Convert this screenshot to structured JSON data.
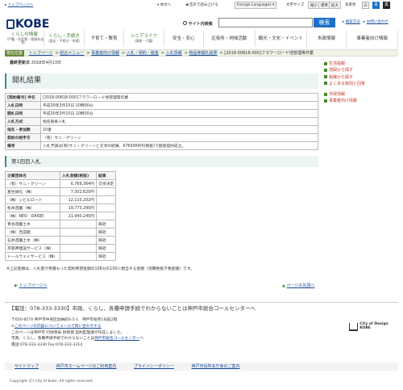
{
  "topbar": {
    "top_link": "トップページへ",
    "text_size": "本文へ",
    "voice": "音声で読み上げる",
    "language": "Foreign Languages",
    "char_size": "文字サイズ",
    "reduce": "縮小",
    "standard": "標準",
    "enlarge": "拡大",
    "bg_color": "背景色",
    "colors": [
      {
        "label": "白",
        "color": "#ffffff",
        "text": "#333333"
      },
      {
        "label": "青",
        "color": "#1d6fc7",
        "text": "#ffffff"
      },
      {
        "label": "黒",
        "color": "#222222",
        "text": "#ffffff"
      }
    ]
  },
  "header": {
    "logo": "KOBE",
    "search_label": "サイト内検索",
    "search_placeholder": "",
    "search_button": "検索",
    "search_help": "検索方法",
    "search_use": "サイトの使い方",
    "contact": "お問い合わせ"
  },
  "nav": [
    {
      "label": "くらしの情報",
      "sub": "（戸籍・住民票・保険年金等）"
    },
    {
      "label": "くらし・手続き",
      "sub": "（届出・手続き・申請）"
    },
    {
      "label": "子育て・教育",
      "sub": ""
    },
    {
      "label": "シニアライフ",
      "sub": "（高齢・介護）"
    },
    {
      "label": "安全・安心",
      "sub": ""
    },
    {
      "label": "区役所・地域活動",
      "sub": ""
    },
    {
      "label": "観光・文化・イベント",
      "sub": ""
    },
    {
      "label": "市政情報",
      "sub": ""
    },
    {
      "label": "事業者向け情報",
      "sub": ""
    }
  ],
  "breadcrumb": {
    "here": "現在位置",
    "items": [
      "トップページ",
      "総合メニュー",
      "事業者向け情報",
      "入札・契約・税金",
      "入札情報",
      "物品等開札結果"
    ],
    "current": "[2018-00818-000]フラワーロード他管理等作業"
  },
  "updated_label": "最終更新日",
  "updated_date": "2018年4月13日",
  "main_title": "開札結果",
  "info_rows": [
    {
      "label": "[契約番号] 件名",
      "value": "[2018-00818-000]フラワーロード他管理等作業"
    },
    {
      "label": "入札日時",
      "value": "平成30年3月15日 10時00分"
    },
    {
      "label": "開札日時",
      "value": "平成30年3月15日 10時30分"
    },
    {
      "label": "入札方式",
      "value": "指名競争入札"
    },
    {
      "label": "指名・参加数",
      "value": "10者"
    },
    {
      "label": "契約の相手方",
      "value": "（有）サニ・グリーン"
    },
    {
      "label": "備考",
      "value": "入札予調は(有)サニ・グリーンと交渉の結果、6769364円(税抜)で随意契約成立。"
    }
  ],
  "section_title": "第1回目入札",
  "bid_headers": [
    "企業団体名",
    "入札金額(税抜)",
    "結果"
  ],
  "bids": [
    {
      "name": "（有）サニ・グリーン",
      "amount": "6,769,364円",
      "result": "交渉決定"
    },
    {
      "name": "富生緑化（株）",
      "amount": "7,302,620円",
      "result": ""
    },
    {
      "name": "（株）シビルロード",
      "amount": "12,110,202円",
      "result": ""
    },
    {
      "name": "松本造園（株）",
      "amount": "19,773,290円",
      "result": ""
    },
    {
      "name": "（株）NEO　DAISEI",
      "amount": "21,940,240円",
      "result": ""
    },
    {
      "name": "青谷造園土木",
      "amount": "",
      "result": "辞退"
    },
    {
      "name": "（株）吉田組",
      "amount": "",
      "result": "辞退"
    },
    {
      "name": "石井造園土木（株）",
      "amount": "",
      "result": "辞退"
    },
    {
      "name": "京阪神建設サービス（株）",
      "amount": "",
      "result": "辞退"
    },
    {
      "name": "トールウェイサービス（株）",
      "amount": "",
      "result": "辞退"
    }
  ],
  "note": "※上記金額は、入札者が見積もった契約希望金額の108分の100に相当する金額（消費税抜き税金額）です。",
  "top_link": "トップページへ",
  "back_link": "ページの先頭へ",
  "side": [
    "生活提報",
    "地図から探す",
    "組織から探す",
    "よくある質問と回答",
    "市政情報",
    "事業者向け情報"
  ],
  "footer": {
    "call": "【電話：078-333-3330】市政、くらし、各種申請手続でわからないことは神戸市総合コールセンターへ",
    "address": "〒650-8570 神戸市中央区加納町6-5-1　神戸市役所1号館2階",
    "inquiry": "このページの内容についてメールで問い合わせする",
    "dept": "このページは神戸市 行財政局 財政部 契約監理課が作成しました。",
    "call2_pre": "市政、くらし、各種申請手続でわからないことは",
    "call2_link": "神戸市総合コールセンター",
    "call2_post": "へ",
    "tel": "電話:078-333-3330 Fax:078-333-3314",
    "unesco": "City of Design KOBE",
    "links": [
      "サイトマップ",
      "神戸市ホームページのご利用案内",
      "プライバシーポリシー",
      "神戸市役所本庁舎のご案内"
    ],
    "copyright": "Copyright (C) City of Kobe. All rights reserved."
  }
}
